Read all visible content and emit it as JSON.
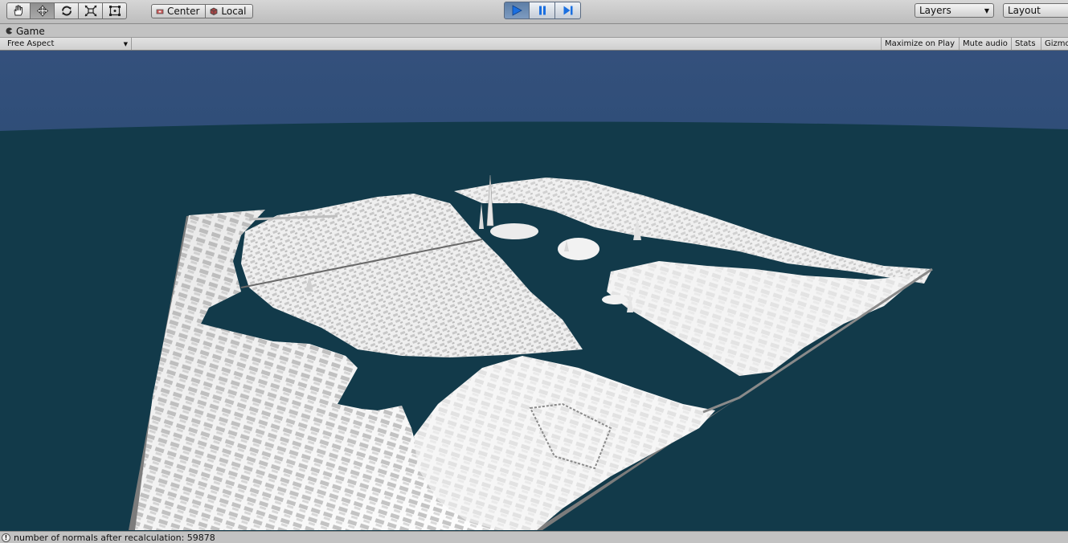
{
  "toolbar": {
    "tools": [
      "hand-tool",
      "move-tool",
      "rotate-tool",
      "scale-tool",
      "rect-tool"
    ],
    "active_tool": "move-tool",
    "pivot_mode_label": "Center",
    "pivot_rotation_label": "Local",
    "play_state": "playing",
    "layers_label": "Layers",
    "layout_label": "Layout"
  },
  "game_view": {
    "tab_label": "Game",
    "aspect_label": "Free Aspect",
    "maximize_label": "Maximize on Play",
    "mute_label": "Mute audio",
    "stats_label": "Stats",
    "gizmos_label": "Gizmos"
  },
  "scene": {
    "sky_color": "#34507c",
    "water_color": "#123a4a",
    "terrain_color": "#f2f2f2",
    "shadow_color": "#7c7c7c"
  },
  "status": {
    "message": "number of normals after recalculation: 59878"
  }
}
